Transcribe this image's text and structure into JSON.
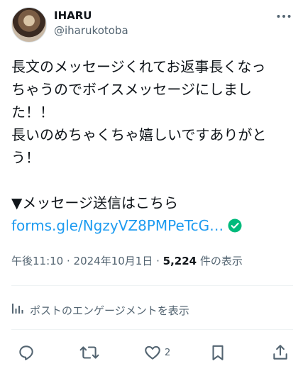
{
  "author": {
    "display_name": "IHARU",
    "handle": "@iharukotoba"
  },
  "tweet": {
    "lines": [
      "長文のメッセージくれてお返事長くなっ",
      "ちゃうのでボイスメッセージにしまし",
      "た！！",
      "長いのめちゃくちゃ嬉しいですありがと",
      "う！",
      "",
      "▼メッセージ送信はこちら"
    ],
    "link_text": "forms.gle/NgzyVZ8PMPeTcG…"
  },
  "meta": {
    "time": "午後11:10",
    "separator": " · ",
    "date": "2024年10月1日",
    "views_count": "5,224",
    "views_label": " 件の表示"
  },
  "engagement_label": "ポストのエンゲージメントを表示",
  "actions": {
    "like_count": "2"
  },
  "colors": {
    "link": "#1d9bf0",
    "verified_badge": "#00ba7c",
    "secondary_text": "#536471"
  },
  "icons": [
    "more-icon",
    "verified-check-icon",
    "analytics-icon",
    "reply-icon",
    "repost-icon",
    "like-icon",
    "bookmark-icon",
    "share-icon"
  ]
}
